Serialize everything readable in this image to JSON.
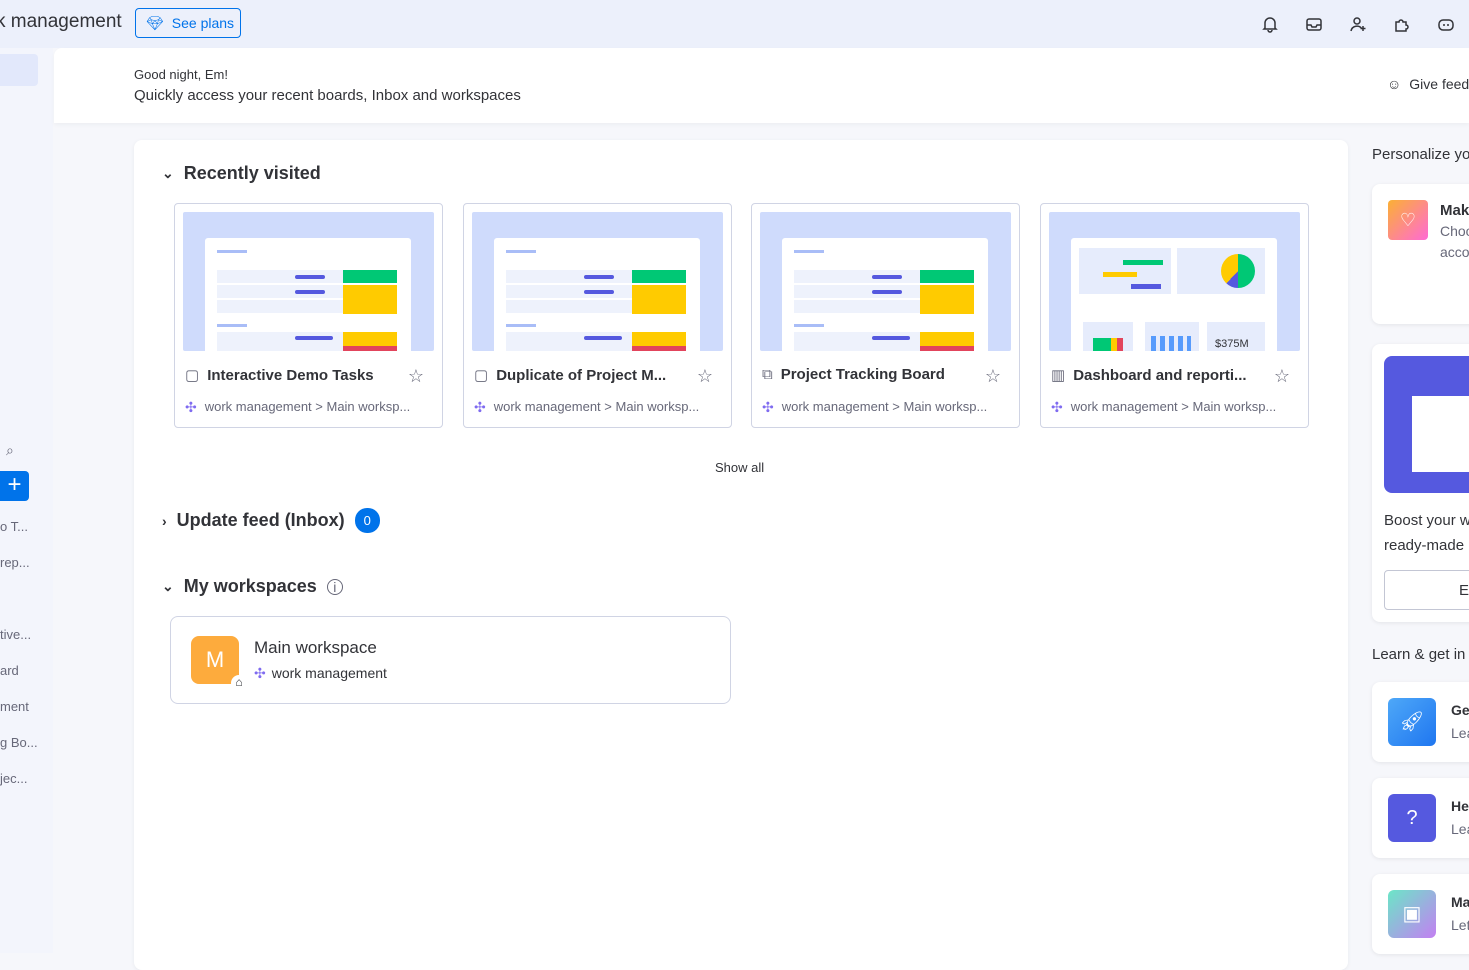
{
  "topbar": {
    "brand": "k management",
    "see_plans": "See plans",
    "icons": [
      "bell-icon",
      "inbox-icon",
      "invite-user-icon",
      "apps-icon",
      "ai-assistant-icon"
    ]
  },
  "sidebar": {
    "items": [
      "o T...",
      "rep...",
      "tive...",
      "ard",
      "ment",
      "g Bo...",
      "jec..."
    ]
  },
  "header": {
    "greeting": "Good night, Em!",
    "subtitle": "Quickly access your recent boards, Inbox and workspaces",
    "feedback": "Give feedback"
  },
  "recent": {
    "title": "Recently visited",
    "show_all": "Show all",
    "boards": [
      {
        "name": "Interactive Demo Tasks",
        "path": "work management > Main worksp...",
        "icon": "board-icon"
      },
      {
        "name": "Duplicate of Project M...",
        "path": "work management > Main worksp...",
        "icon": "board-icon"
      },
      {
        "name": "Project Tracking Board",
        "path": "work management > Main worksp...",
        "icon": "shared-board-icon"
      },
      {
        "name": "Dashboard and reporti...",
        "path": "work management > Main worksp...",
        "icon": "dashboard-icon",
        "stat": "$375M"
      }
    ]
  },
  "inbox": {
    "title": "Update feed (Inbox)",
    "count": "0"
  },
  "workspaces": {
    "title": "My workspaces",
    "items": [
      {
        "initial": "M",
        "name": "Main workspace",
        "sub": "work management",
        "color": "#fdab3d"
      }
    ]
  },
  "right": {
    "personalize": "Personalize yo",
    "make_title": "Mak",
    "make_sub1": "Choo",
    "make_sub2": "acco",
    "boost1": "Boost your w",
    "boost2": "ready-made",
    "explore": "Ex",
    "learn": "Learn & get in",
    "items": [
      {
        "t": "Ge",
        "s": "Lea"
      },
      {
        "t": "He",
        "s": "Lea"
      },
      {
        "t": "Ma",
        "s": "Let"
      }
    ]
  }
}
